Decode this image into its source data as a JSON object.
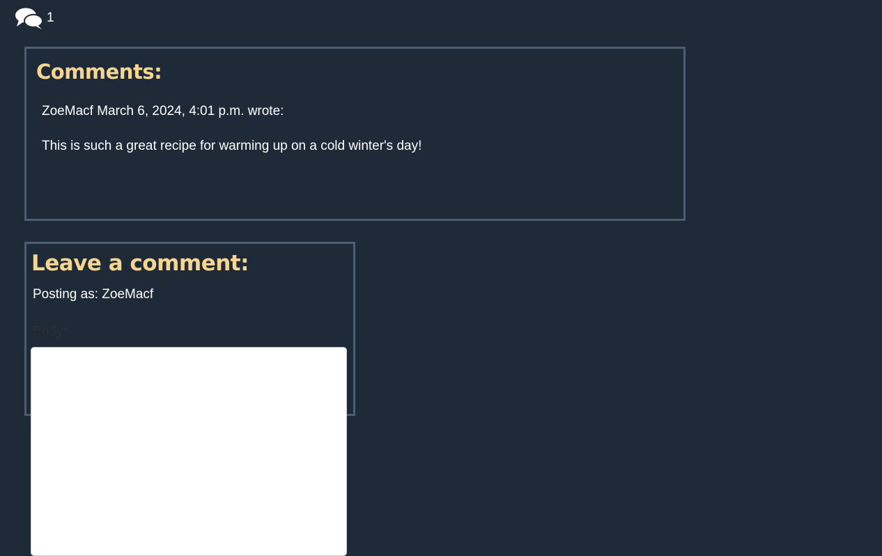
{
  "header": {
    "icon": "comments-icon",
    "comment_count": "1"
  },
  "comments": {
    "title": "Comments:",
    "items": [
      {
        "meta": "ZoeMacf March 6, 2024, 4:01 p.m. wrote:",
        "body": "This is such a great recipe for warming up on a cold winter's day!"
      }
    ]
  },
  "leave_comment": {
    "title": "Leave a comment:",
    "posting_as": "Posting as: ZoeMacf",
    "body_label": "Body*",
    "body_value": ""
  },
  "colors": {
    "background": "#1f2a38",
    "heading": "#f5d590",
    "border": "#4a5d73",
    "text": "#ffffff"
  }
}
